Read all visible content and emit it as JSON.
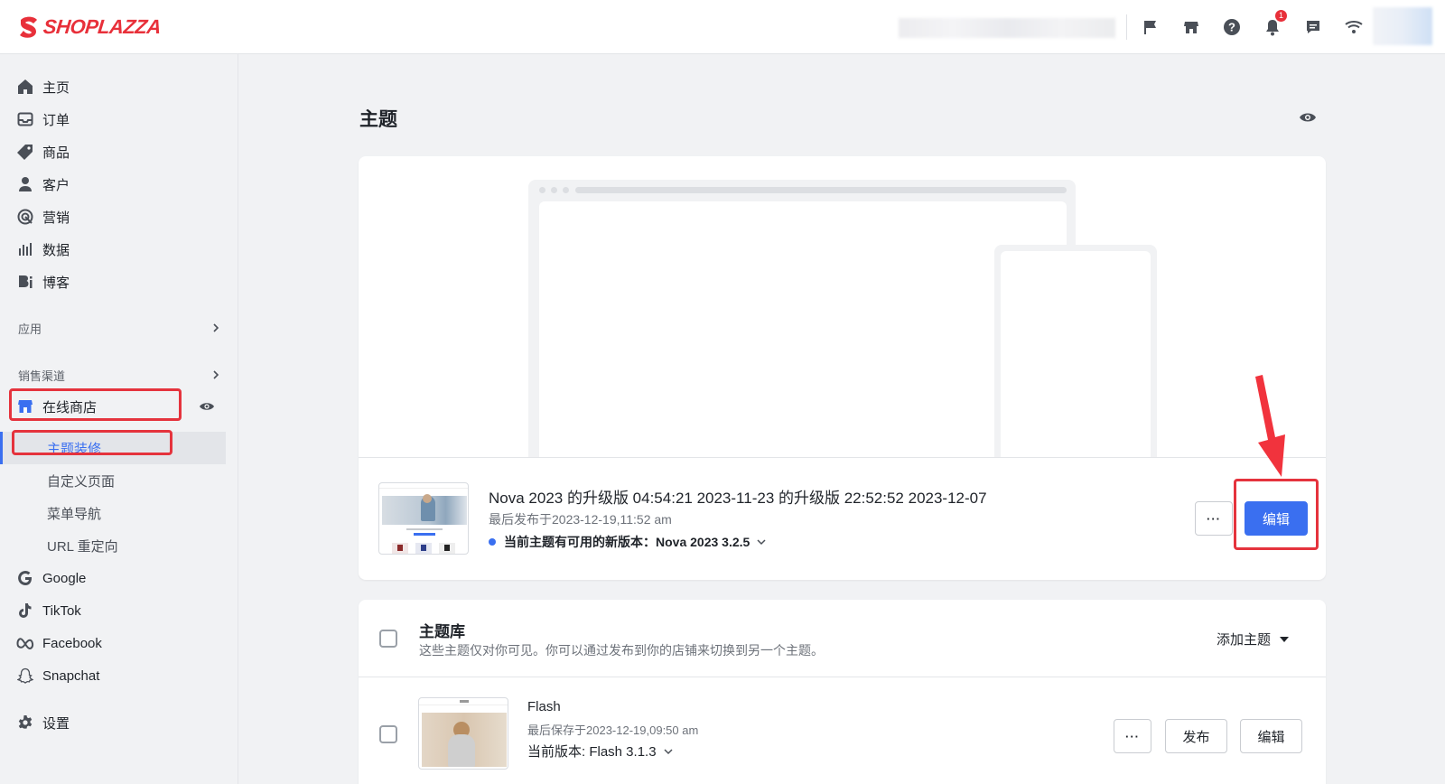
{
  "header": {
    "brand": "SHOPLAZZA",
    "brand_color": "#e8303a",
    "icons": [
      "flag-icon",
      "store-icon",
      "help-icon",
      "bell-icon",
      "message-icon",
      "wifi-icon"
    ],
    "notification_count": "1"
  },
  "sidebar": {
    "items": [
      {
        "label": "主页",
        "icon": "home-icon"
      },
      {
        "label": "订单",
        "icon": "inbox-icon"
      },
      {
        "label": "商品",
        "icon": "tag-icon"
      },
      {
        "label": "客户",
        "icon": "user-icon"
      },
      {
        "label": "营销",
        "icon": "marketing-icon"
      },
      {
        "label": "数据",
        "icon": "chart-icon"
      },
      {
        "label": "博客",
        "icon": "blog-icon"
      }
    ],
    "apps_label": "应用",
    "channels_label": "销售渠道",
    "online_store": "在线商店",
    "sub_items": [
      "主题装修",
      "自定义页面",
      "菜单导航",
      "URL 重定向"
    ],
    "channels": [
      {
        "label": "Google",
        "icon": "google-icon"
      },
      {
        "label": "TikTok",
        "icon": "tiktok-icon"
      },
      {
        "label": "Facebook",
        "icon": "meta-icon"
      },
      {
        "label": "Snapchat",
        "icon": "snapchat-icon"
      }
    ],
    "settings": "设置",
    "accent_color": "#3a6ff0"
  },
  "main": {
    "title": "主题",
    "current_theme": {
      "name": "Nova 2023 的升级版 04:54:21 2023-11-23 的升级版 22:52:52 2023-12-07",
      "published": "最后发布于2023-12-19,11:52 am",
      "update_notice": "当前主题有可用的新版本：Nova 2023 3.2.5",
      "more_label": "···",
      "edit_label": "编辑"
    },
    "library": {
      "title": "主题库",
      "description": "这些主题仅对你可见。你可以通过发布到你的店铺来切换到另一个主题。",
      "add_label": "添加主题",
      "themes": [
        {
          "name": "Flash",
          "saved": "最后保存于2023-12-19,09:50 am",
          "version": "当前版本: Flash 3.1.3",
          "more_label": "···",
          "publish_label": "发布",
          "edit_label": "编辑"
        }
      ]
    }
  }
}
